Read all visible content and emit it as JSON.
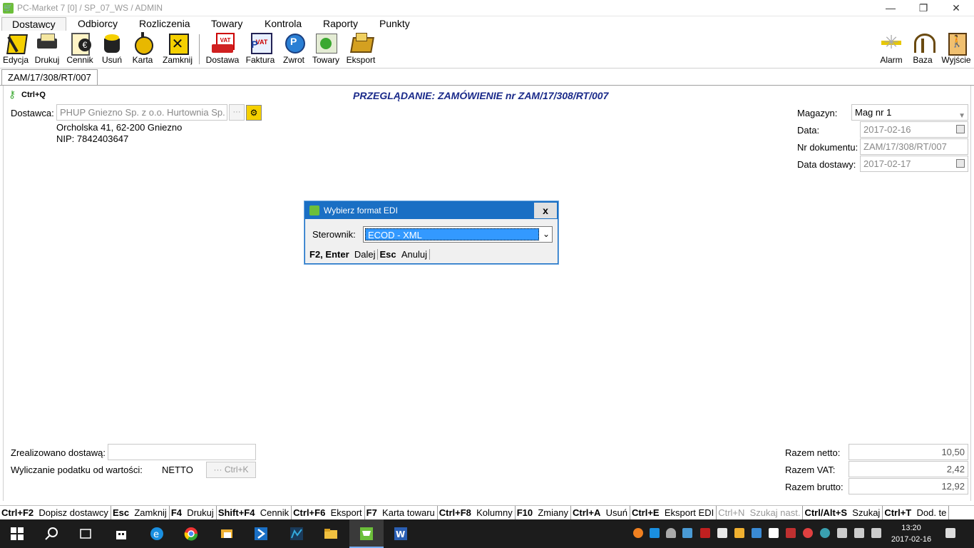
{
  "window": {
    "title": "PC-Market 7 [0] / SP_07_WS / ADMIN",
    "minimize": "—",
    "restore": "❐",
    "close": "✕"
  },
  "menu": [
    "Dostawcy",
    "Odbiorcy",
    "Rozliczenia",
    "Towary",
    "Kontrola",
    "Raporty",
    "Punkty"
  ],
  "toolbar": {
    "left": [
      "Edycja",
      "Drukuj",
      "Cennik",
      "Usuń",
      "Karta",
      "Zamknij"
    ],
    "middle": [
      "Dostawa",
      "Faktura",
      "Zwrot",
      "Towary",
      "Eksport"
    ],
    "right": [
      "Alarm",
      "Baza",
      "Wyjście"
    ]
  },
  "doc_tab": "ZAM/17/308/RT/007",
  "shortcut_hint": "Ctrl+Q",
  "heading": "PRZEGLĄDANIE: ZAMÓWIENIE nr ZAM/17/308/RT/007",
  "supplier": {
    "label": "Dostawca:",
    "value": "PHUP Gniezno Sp. z o.o. Hurtownia Sp.",
    "ellipsis": "···",
    "address": "Orcholska 41, 62-200 Gniezno",
    "nip": "NIP: 7842403647"
  },
  "right_fields": {
    "magazyn_label": "Magazyn:",
    "magazyn_value": "Mag nr 1",
    "data_label": "Data:",
    "data_value": "2017-02-16",
    "nr_label": "Nr dokumentu:",
    "nr_value": "ZAM/17/308/RT/007",
    "dostawa_label": "Data dostawy:",
    "dostawa_value": "2017-02-17"
  },
  "bottom_left": {
    "zrealizowano_label": "Zrealizowano dostawą:",
    "zrealizowano_value": "",
    "podatek_label": "Wyliczanie podatku od wartości:",
    "podatek_value": "NETTO",
    "podatek_btn": "··· Ctrl+K"
  },
  "totals": {
    "netto_label": "Razem netto:",
    "netto_value": "10,50",
    "vat_label": "Razem VAT:",
    "vat_value": "2,42",
    "brutto_label": "Razem brutto:",
    "brutto_value": "12,92"
  },
  "dialog": {
    "title": "Wybierz format EDI",
    "close": "x",
    "label": "Sterownik:",
    "selected": "ECOD - XML",
    "key1": "F2, Enter",
    "act1": "Dalej",
    "key2": "Esc",
    "act2": "Anuluj"
  },
  "statusbar": [
    {
      "key": "Ctrl+F2",
      "action": "Dopisz dostawcy",
      "disabled": false
    },
    {
      "key": "Esc",
      "action": "Zamknij",
      "disabled": false
    },
    {
      "key": "F4",
      "action": "Drukuj",
      "disabled": false
    },
    {
      "key": "Shift+F4",
      "action": "Cennik",
      "disabled": false
    },
    {
      "key": "Ctrl+F6",
      "action": "Eksport",
      "disabled": false
    },
    {
      "key": "F7",
      "action": "Karta towaru",
      "disabled": false
    },
    {
      "key": "Ctrl+F8",
      "action": "Kolumny",
      "disabled": false
    },
    {
      "key": "F10",
      "action": "Zmiany",
      "disabled": false
    },
    {
      "key": "Ctrl+A",
      "action": "Usuń",
      "disabled": false
    },
    {
      "key": "Ctrl+E",
      "action": "Eksport EDI",
      "disabled": false
    },
    {
      "key": "Ctrl+N",
      "action": "Szukaj nast.",
      "disabled": true
    },
    {
      "key": "Ctrl/Alt+S",
      "action": "Szukaj",
      "disabled": false
    },
    {
      "key": "Ctrl+T",
      "action": "Dod. te",
      "disabled": false
    }
  ],
  "clock": {
    "time": "13:20",
    "date": "2017-02-16"
  },
  "colors": {
    "accent": "#1a6fc4",
    "heading": "#1a2a8a",
    "taskbar": "#1c1c1c"
  }
}
